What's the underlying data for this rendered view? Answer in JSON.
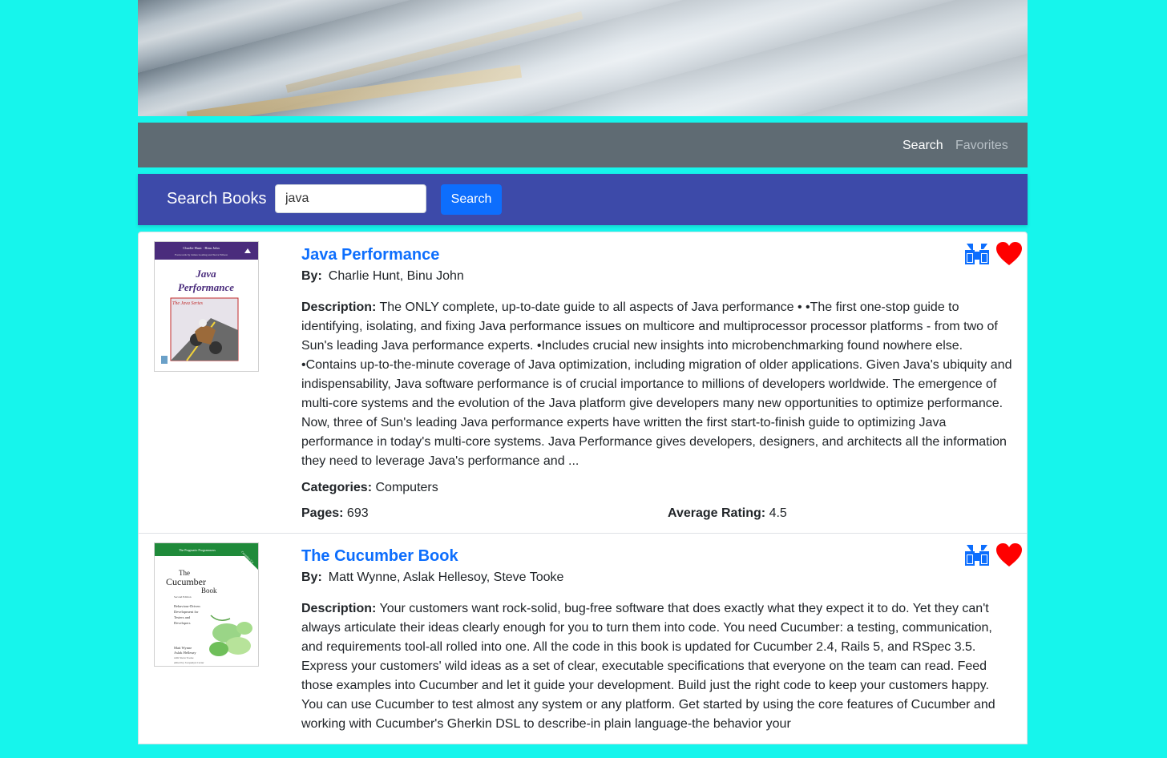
{
  "nav": {
    "search_label": "Search",
    "favorites_label": "Favorites"
  },
  "search": {
    "title": "Search Books",
    "query": "java",
    "button_label": "Search"
  },
  "labels": {
    "by": "By:",
    "description": "Description:",
    "categories": "Categories:",
    "pages": "Pages:",
    "average_rating": "Average Rating:"
  },
  "colors": {
    "page_background": "#16f5ec",
    "navbar": "#5f6b73",
    "search_bar": "#3d4aa9",
    "primary": "#0d6efd",
    "heart": "#ff0000"
  },
  "books": [
    {
      "title": "Java Performance",
      "authors": "Charlie Hunt, Binu John",
      "description": "The ONLY complete, up-to-date guide to all aspects of Java performance • •The first one-stop guide to identifying, isolating, and fixing Java performance issues on multicore and multiprocessor processor platforms - from two of Sun's leading Java performance experts. •Includes crucial new insights into microbenchmarking found nowhere else. •Contains up-to-the-minute coverage of Java optimization, including migration of older applications. Given Java's ubiquity and indispensability, Java software performance is of crucial importance to millions of developers worldwide. The emergence of multi-core systems and the evolution of the Java platform give developers many new opportunities to optimize performance. Now, three of Sun's leading Java performance experts have written the first start-to-finish guide to optimizing Java performance in today's multi-core systems. Java Performance gives developers, designers, and architects all the information they need to leverage Java's performance and ...",
      "categories": "Computers",
      "pages": "693",
      "average_rating": "4.5",
      "cover": {
        "authors_line": "Charlie Hunt · Binu John",
        "foreword_line": "Forewords by James Gosling and Steve Wilson",
        "title_line1": "Java",
        "title_line2": "Performance",
        "series": "The Java Series",
        "accent": "#4a2c7c"
      }
    },
    {
      "title": "The Cucumber Book",
      "authors": "Matt Wynne, Aslak Hellesoy, Steve Tooke",
      "description": "Your customers want rock-solid, bug-free software that does exactly what they expect it to do. Yet they can't always articulate their ideas clearly enough for you to turn them into code. You need Cucumber: a testing, communication, and requirements tool-all rolled into one. All the code in this book is updated for Cucumber 2.4, Rails 5, and RSpec 3.5. Express your customers' wild ideas as a set of clear, executable specifications that everyone on the team can read. Feed those examples into Cucumber and let it guide your development. Build just the right code to keep your customers happy. You can use Cucumber to test almost any system or any platform. Get started by using the core features of Cucumber and working with Cucumber's Gherkin DSL to describe-in plain language-the behavior your",
      "cover": {
        "publisher": "The Pragmatic Programmers",
        "edition_corner": "Cucumber 2.4",
        "title_line1": "The",
        "title_line2": "Cucumber",
        "title_line3": "Book",
        "edition": "Second Edition",
        "subtitle": "Behaviour-Driven Development for Testers and Developers",
        "authors_line1": "Matt Wynne",
        "authors_line2": "Aslak Hellesøy",
        "authors_line3": "with Steve Tooke",
        "editor_line": "edited by Jacquelyn Carter",
        "accent": "#1f8a3a"
      }
    }
  ]
}
